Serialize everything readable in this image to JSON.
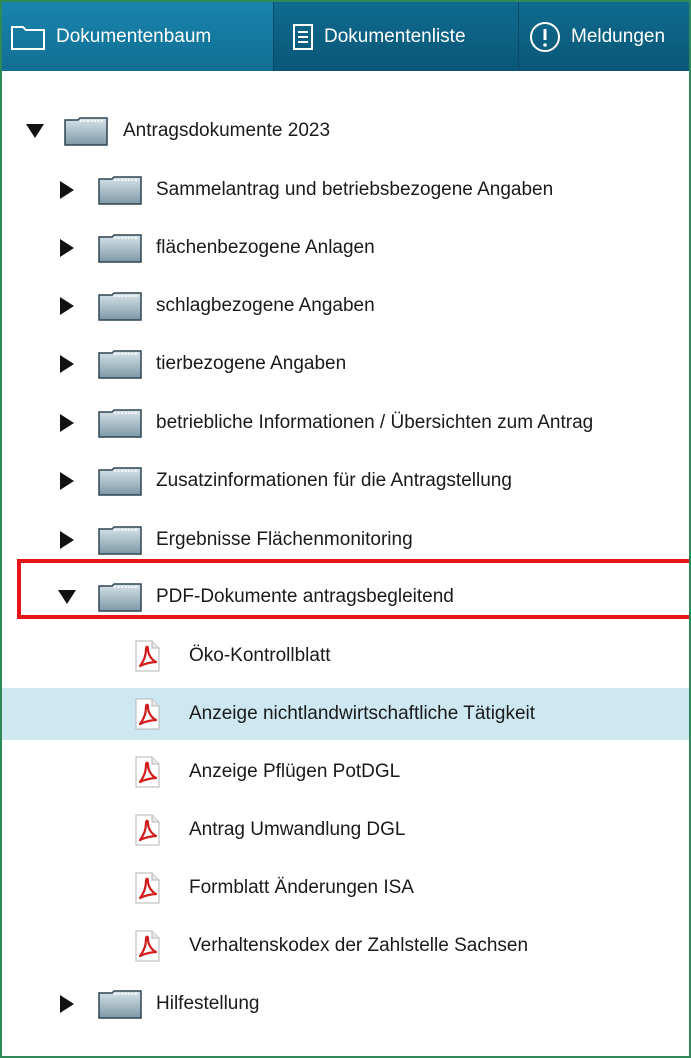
{
  "tabs": [
    {
      "label": "Dokumentenbaum",
      "icon": "folder-icon",
      "active": true
    },
    {
      "label": "Dokumentenliste",
      "icon": "document-list-icon",
      "active": false
    },
    {
      "label": "Meldungen",
      "icon": "exclamation-circle-icon",
      "active": false
    }
  ],
  "tree": {
    "root": {
      "label": "Antragsdokumente 2023",
      "expanded": true
    },
    "folders": [
      {
        "label": "Sammelantrag und betriebsbezogene Angaben",
        "expanded": false
      },
      {
        "label": "flächenbezogene Anlagen",
        "expanded": false
      },
      {
        "label": "schlagbezogene Angaben",
        "expanded": false
      },
      {
        "label": "tierbezogene Angaben",
        "expanded": false
      },
      {
        "label": "betriebliche Informationen / Übersichten zum Antrag",
        "expanded": false
      },
      {
        "label": "Zusatzinformationen für die Antragstellung",
        "expanded": false
      },
      {
        "label": "Ergebnisse Flächenmonitoring",
        "expanded": false
      },
      {
        "label": "PDF-Dokumente antragsbegleitend",
        "expanded": true,
        "highlighted": true
      }
    ],
    "documents": [
      {
        "label": "Öko-Kontrollblatt",
        "icon": "pdf-icon",
        "selected": false
      },
      {
        "label": "Anzeige nichtlandwirtschaftliche Tätigkeit",
        "icon": "pdf-icon",
        "selected": true
      },
      {
        "label": "Anzeige Pflügen PotDGL",
        "icon": "pdf-icon",
        "selected": false
      },
      {
        "label": "Antrag Umwandlung DGL",
        "icon": "pdf-icon",
        "selected": false
      },
      {
        "label": "Formblatt Änderungen ISA",
        "icon": "pdf-icon",
        "selected": false
      },
      {
        "label": "Verhaltenskodex der Zahlstelle Sachsen",
        "icon": "pdf-icon",
        "selected": false
      }
    ],
    "last_folder": {
      "label": "Hilfestellung",
      "expanded": false
    }
  },
  "colors": {
    "tabbar": "#0f6b8f",
    "selected_row": "#cde8f1",
    "highlight_border": "#e8141a",
    "frame_border": "#2e8b57"
  }
}
